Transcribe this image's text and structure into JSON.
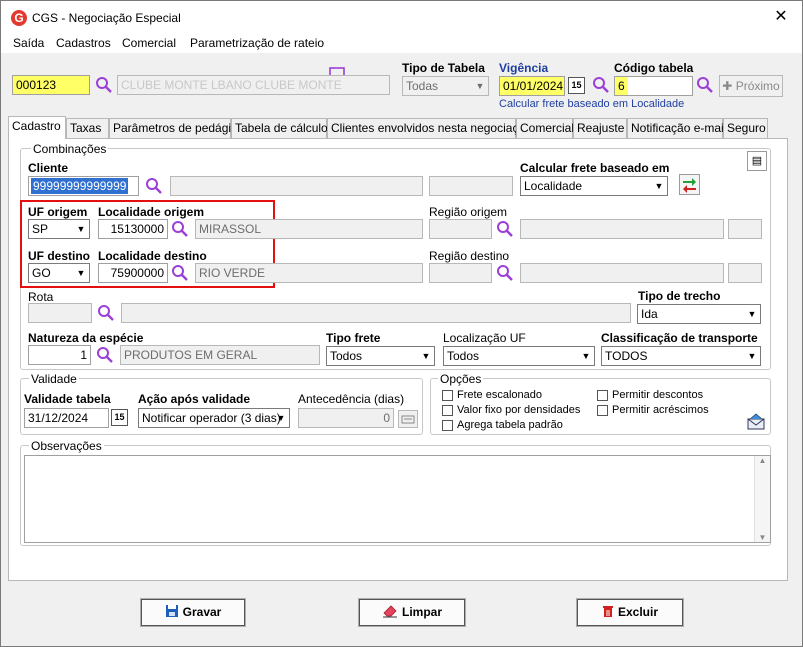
{
  "window": {
    "title": "CGS - Negociação Especial",
    "close_glyph": "✕",
    "app_icon": "G"
  },
  "menu": [
    "Saída",
    "Cadastros",
    "Comercial",
    "Parametrização de rateio"
  ],
  "header": {
    "code_value": "000123",
    "name_value": "CLUBE MONTE LBANO    CLUBE MONTE",
    "tipo_tabela_label": "Tipo de Tabela",
    "tipo_tabela_value": "Todas",
    "vigencia_label": "Vigência",
    "vigencia_value": "01/01/2024",
    "codigo_tabela_label": "Código tabela",
    "codigo_tabela_value": "6",
    "proximo_label": "Próximo",
    "calc_link": "Calcular frete baseado em Localidade"
  },
  "tabs": [
    "Cadastro",
    "Taxas",
    "Parâmetros de pedágio",
    "Tabela de cálculo",
    "Clientes envolvidos nesta negociação",
    "Comercial",
    "Reajuste",
    "Notificação e-mail",
    "Seguro"
  ],
  "combinacoes": {
    "group_label": "Combinações",
    "cliente_label": "Cliente",
    "cliente_value": "99999999999999",
    "calc_frete_label": "Calcular frete baseado em",
    "calc_frete_value": "Localidade",
    "uf_origem_label": "UF origem",
    "uf_origem_value": "SP",
    "loc_origem_label": "Localidade origem",
    "loc_origem_code": "15130000",
    "loc_origem_name": "MIRASSOL",
    "regiao_origem_label": "Região origem",
    "uf_destino_label": "UF destino",
    "uf_destino_value": "GO",
    "loc_destino_label": "Localidade destino",
    "loc_destino_code": "75900000",
    "loc_destino_name": "RIO VERDE",
    "regiao_destino_label": "Região destino",
    "rota_label": "Rota",
    "tipo_trecho_label": "Tipo de trecho",
    "tipo_trecho_value": "Ida",
    "natureza_label": "Natureza da espécie",
    "natureza_code": "1",
    "natureza_name": "PRODUTOS EM GERAL",
    "tipo_frete_label": "Tipo frete",
    "tipo_frete_value": "Todos",
    "localizacao_uf_label": "Localização UF",
    "localizacao_uf_value": "Todos",
    "classificacao_label": "Classificação de transporte",
    "classificacao_value": "TODOS"
  },
  "validade": {
    "group_label": "Validade",
    "validade_tabela_label": "Validade tabela",
    "validade_tabela_value": "31/12/2024",
    "acao_label": "Ação após validade",
    "acao_value": "Notificar operador (3 dias)",
    "antecedencia_label": "Antecedência (dias)",
    "antecedencia_value": "0"
  },
  "opcoes": {
    "group_label": "Opções",
    "frete_escalonado": "Frete escalonado",
    "valor_fixo": "Valor fixo por densidades",
    "agrega_tabela": "Agrega tabela padrão",
    "permitir_descontos": "Permitir descontos",
    "permitir_acrescimos": "Permitir acréscimos"
  },
  "observacoes": {
    "group_label": "Observações"
  },
  "buttons": {
    "gravar": "Gravar",
    "limpar": "Limpar",
    "excluir": "Excluir"
  },
  "colors": {
    "highlight_yellow": "#ffff66",
    "accent_blue": "#1f3fa0",
    "search_purple": "#9b3fd6",
    "red_box": "#e31010"
  }
}
